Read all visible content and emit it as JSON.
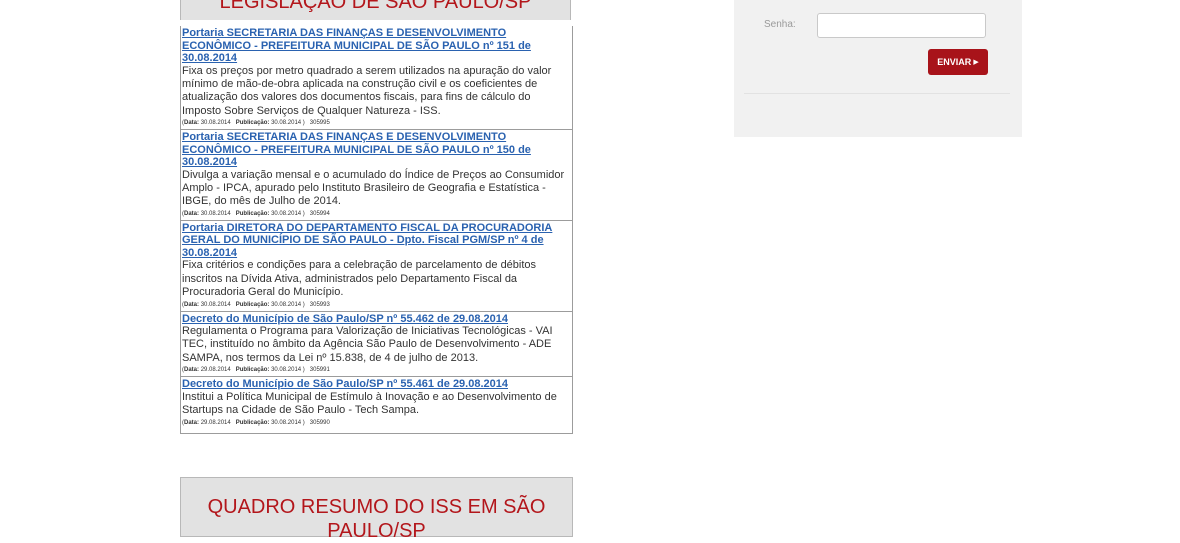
{
  "legislacao": {
    "heading": "LEGISLAÇÃO DE SÃO PAULO/SP",
    "items": [
      {
        "title": "Portaria SECRETARIA DAS FINANÇAS E DESENVOLVIMENTO ECONÔMICO - PREFEITURA MUNICIPAL DE SÃO PAULO nº 151 de 30.08.2014",
        "description": "Fixa os preços por metro quadrado a serem utilizados na apuração do valor mínimo de mão-de-obra aplicada na construção civil e os coeficientes de atualização dos valores dos documentos fiscais, para fins de cálculo do Imposto Sobre Serviços de Qualquer Natureza - ISS.",
        "data_label": "Data:",
        "data": "30.08.2014",
        "publicacao_label": "Publicação:",
        "publicacao": "30.08.2014",
        "id": "305995"
      },
      {
        "title": "Portaria SECRETARIA DAS FINANÇAS E DESENVOLVIMENTO ECONÔMICO - PREFEITURA MUNICIPAL DE SÃO PAULO nº 150 de 30.08.2014",
        "description": "Divulga a variação mensal e o acumulado do Índice de Preços ao Consumidor Amplo - IPCA, apurado pelo Instituto Brasileiro de Geografia e Estatística - IBGE, do mês de Julho de 2014.",
        "data_label": "Data:",
        "data": "30.08.2014",
        "publicacao_label": "Publicação:",
        "publicacao": "30.08.2014",
        "id": "305994"
      },
      {
        "title": "Portaria DIRETORA DO DEPARTAMENTO FISCAL DA PROCURADORIA GERAL DO MUNICÍPIO DE SÃO PAULO - Dpto. Fiscal PGM/SP nº 4 de 30.08.2014",
        "description": "Fixa critérios e condições para a celebração de parcelamento de débitos inscritos na Dívida Ativa, administrados pelo Departamento Fiscal da Procuradoria Geral do Município.",
        "data_label": "Data:",
        "data": "30.08.2014",
        "publicacao_label": "Publicação:",
        "publicacao": "30.08.2014",
        "id": "305993"
      },
      {
        "title": "Decreto do Município de São Paulo/SP nº 55.462 de 29.08.2014",
        "description": "Regulamenta o Programa para Valorização de Iniciativas Tecnológicas - VAI TEC, instituído no âmbito da Agência São Paulo de Desenvolvimento - ADE SAMPA, nos termos da Lei nº 15.838, de 4 de julho de 2013.",
        "data_label": "Data:",
        "data": "29.08.2014",
        "publicacao_label": "Publicação:",
        "publicacao": "30.08.2014",
        "id": "305991"
      },
      {
        "title": "Decreto do Município de São Paulo/SP nº 55.461 de 29.08.2014",
        "description": "Institui a Política Municipal de Estímulo à Inovação e ao Desenvolvimento de Startups na Cidade de São Paulo - Tech Sampa.",
        "data_label": "Data:",
        "data": "29.08.2014",
        "publicacao_label": "Publicação:",
        "publicacao": "30.08.2014",
        "id": "305990"
      }
    ]
  },
  "quadro": {
    "heading": "QUADRO RESUMO DO ISS EM SÃO PAULO/SP"
  },
  "login": {
    "senha_label": "Senha:",
    "senha_value": "",
    "submit_label": "ENVIAR",
    "submit_icon": "arrow-right-icon"
  },
  "colors": {
    "accent_red": "#b3161b",
    "button_red": "#a8131a",
    "link_blue": "#2a62b0",
    "panel_gray": "#f1f1f1",
    "header_gray": "#e2e2e2"
  }
}
